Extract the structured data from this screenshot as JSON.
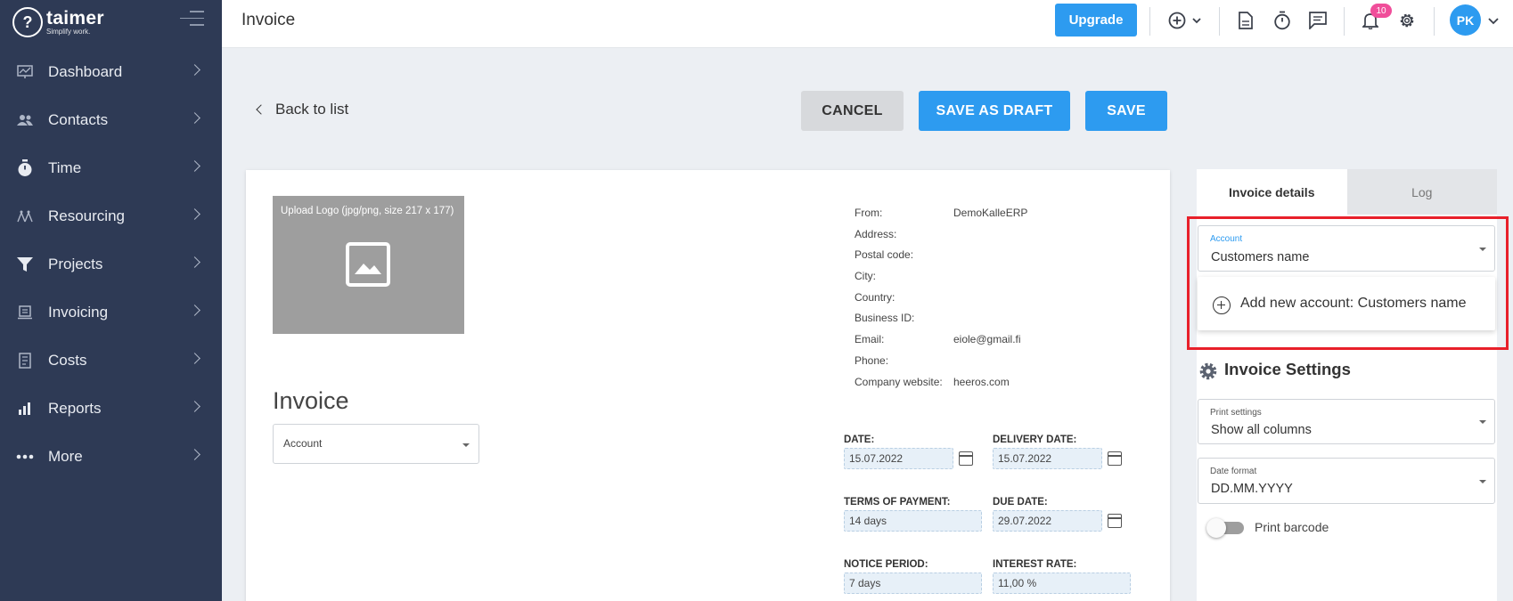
{
  "app": {
    "logo_name": "taimer",
    "logo_tagline": "Simplify work.",
    "page_title": "Invoice"
  },
  "sidebar": {
    "items": [
      {
        "label": "Dashboard",
        "icon": "dashboard-icon"
      },
      {
        "label": "Contacts",
        "icon": "contacts-icon"
      },
      {
        "label": "Time",
        "icon": "stopwatch-icon"
      },
      {
        "label": "Resourcing",
        "icon": "resourcing-icon"
      },
      {
        "label": "Projects",
        "icon": "funnel-icon"
      },
      {
        "label": "Invoicing",
        "icon": "invoice-icon"
      },
      {
        "label": "Costs",
        "icon": "receipt-icon"
      },
      {
        "label": "Reports",
        "icon": "bar-chart-icon"
      },
      {
        "label": "More",
        "icon": "more-dots-icon"
      }
    ]
  },
  "topbar": {
    "upgrade_label": "Upgrade",
    "notification_count": "10",
    "avatar_initials": "PK"
  },
  "actions": {
    "back_label": "Back to list",
    "cancel_label": "CANCEL",
    "draft_label": "SAVE AS DRAFT",
    "save_label": "SAVE"
  },
  "invoice": {
    "upload_logo_label": "Upload Logo (jpg/png, size 217 x 177)",
    "title": "Invoice",
    "account_placeholder": "Account",
    "from_rows": [
      {
        "label": "From:",
        "value": "DemoKalleERP"
      },
      {
        "label": "Address:",
        "value": ""
      },
      {
        "label": "Postal code:",
        "value": ""
      },
      {
        "label": "City:",
        "value": ""
      },
      {
        "label": "Country:",
        "value": ""
      },
      {
        "label": "Business ID:",
        "value": ""
      },
      {
        "label": "Email:",
        "value": "eiole@gmail.fi"
      },
      {
        "label": "Phone:",
        "value": ""
      },
      {
        "label": "Company website:",
        "value": "heeros.com"
      }
    ],
    "date_label": "DATE:",
    "date_value": "15.07.2022",
    "delivery_label": "DELIVERY DATE:",
    "delivery_value": "15.07.2022",
    "terms_label": "TERMS OF PAYMENT:",
    "terms_value": "14  days",
    "due_label": "DUE DATE:",
    "due_value": "29.07.2022",
    "notice_label": "NOTICE PERIOD:",
    "notice_value": "7    days",
    "interest_label": "INTEREST RATE:",
    "interest_value": "11,00  %"
  },
  "right_panel": {
    "tab_details": "Invoice details",
    "tab_log": "Log",
    "account_label": "Account",
    "account_value": "Customers name",
    "add_account_label": "Add new account: Customers name",
    "settings_title": "Invoice Settings",
    "print_label": "Print settings",
    "print_value": "Show all columns",
    "date_format_label": "Date format",
    "date_format_value": "DD.MM.YYYY",
    "barcode_label": "Print barcode"
  },
  "colors": {
    "sidebar_bg": "#2e3a55",
    "accent": "#2d9bf0",
    "highlight": "#e8202a",
    "badge": "#f04e9a"
  }
}
